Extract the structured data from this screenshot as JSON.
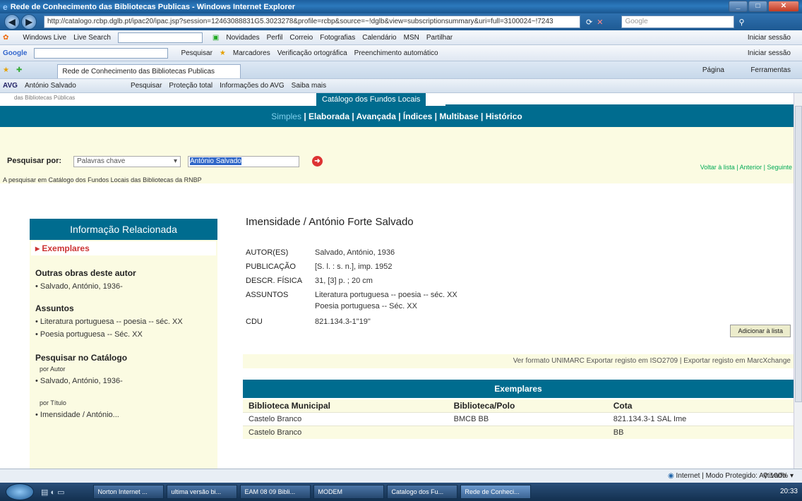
{
  "window": {
    "title": "Rede de Conhecimento das Bibliotecas Publicas - Windows Internet Explorer",
    "address": "http://catalogo.rcbp.dglb.pt/ipac20/ipac.jsp?session=12463088831G5.3023278&profile=rcbp&source=~!dglb&view=subscriptionsummary&uri=full=3100024~!7243",
    "search_placeholder": "Google"
  },
  "toolbars": {
    "windows_live": "Windows Live",
    "live_search": "Live Search",
    "links": [
      "Novidades",
      "Perfil",
      "Correio",
      "Fotografias",
      "Calendário",
      "MSN",
      "Partilhar"
    ],
    "iniciar_sessao": "Iniciar sessão",
    "google": "Google",
    "pesquisar": "Pesquisar",
    "marcadores": "Marcadores",
    "verificacao": "Verificação ortográfica",
    "preenchimento": "Preenchimento automático",
    "iniciar_sessao2": "Iniciar sessão",
    "tab_label": "Rede de Conhecimento das Bibliotecas Publicas",
    "pagina": "Página",
    "ferramentas": "Ferramentas",
    "avg": "AVG",
    "avg_user": "António Salvado",
    "avg_pesquisar": "Pesquisar",
    "avg_protecao": "Proteção total",
    "avg_info": "Informações do AVG",
    "avg_saiba": "Saiba mais"
  },
  "header": {
    "library_note": "das Bibliotecas Públicas",
    "catalog_title": "Catálogo dos Fundos Locais"
  },
  "modes": {
    "simples": "Simples",
    "elaborada": "Elaborada",
    "avancada": "Avançada",
    "indices": "Índices",
    "multibase": "Multibase",
    "historico": "Histórico"
  },
  "search": {
    "label": "Pesquisar por:",
    "field": "Palavras chave",
    "query": "António Salvado",
    "scope": "A pesquisar em Catálogo dos Fundos Locais das Bibliotecas da RNBP",
    "voltar": "Voltar à lista",
    "anterior": "Anterior",
    "seguinte": "Seguinte"
  },
  "sidebar": {
    "title": "Informação Relacionada",
    "exemplares": "Exemplares",
    "outras_obras": "Outras obras deste autor",
    "autor_link": "Salvado, António, 1936-",
    "assuntos": "Assuntos",
    "assunto1": "Literatura portuguesa -- poesia -- séc. XX",
    "assunto2": "Poesia portuguesa -- Séc. XX",
    "pesquisar_catalogo": "Pesquisar no Catálogo",
    "por_autor": "por Autor",
    "autor_link2": "Salvado, António, 1936-",
    "por_titulo": "por Título",
    "titulo_link": "Imensidade / António..."
  },
  "record": {
    "title": "Imensidade / António Forte Salvado",
    "autor_label": "AUTOR(ES)",
    "autor_value": "Salvado, António, 1936",
    "publicacao_label": "PUBLICAÇÃO",
    "publicacao_value": "[S. l. : s. n.], imp. 1952",
    "descr_label": "DESCR. FÍSICA",
    "descr_value": "31, [3] p. ; 20 cm",
    "assuntos_label": "ASSUNTOS",
    "assuntos_value1": "Literatura portuguesa -- poesia -- séc. XX",
    "assuntos_value2": "Poesia portuguesa -- Séc. XX",
    "cdu_label": "CDU",
    "cdu_value": "821.134.3-1\"19\"",
    "add_button": "Adicionar à lista",
    "format_links": "Ver formato UNIMARC  Exportar registo em ISO2709 | Exportar registo em MarcXchange"
  },
  "exemplares": {
    "title": "Exemplares",
    "columns": [
      "Biblioteca Municipal",
      "Biblioteca/Polo",
      "Cota"
    ],
    "rows": [
      [
        "Castelo Branco",
        "BMCB BB",
        "821.134.3-1 SAL Ime"
      ],
      [
        "Castelo Branco",
        "",
        "BB"
      ]
    ]
  },
  "status": {
    "zone": "Internet | Modo Protegido: Activado",
    "zoom": "100%"
  },
  "taskbar": {
    "items": [
      "Norton Internet ...",
      "ultima versão bi...",
      "EAM 08 09 Bibli...",
      "MODEM",
      "Catalogo dos Fu...",
      "Rede de Conheci..."
    ],
    "clock": "20:33"
  }
}
